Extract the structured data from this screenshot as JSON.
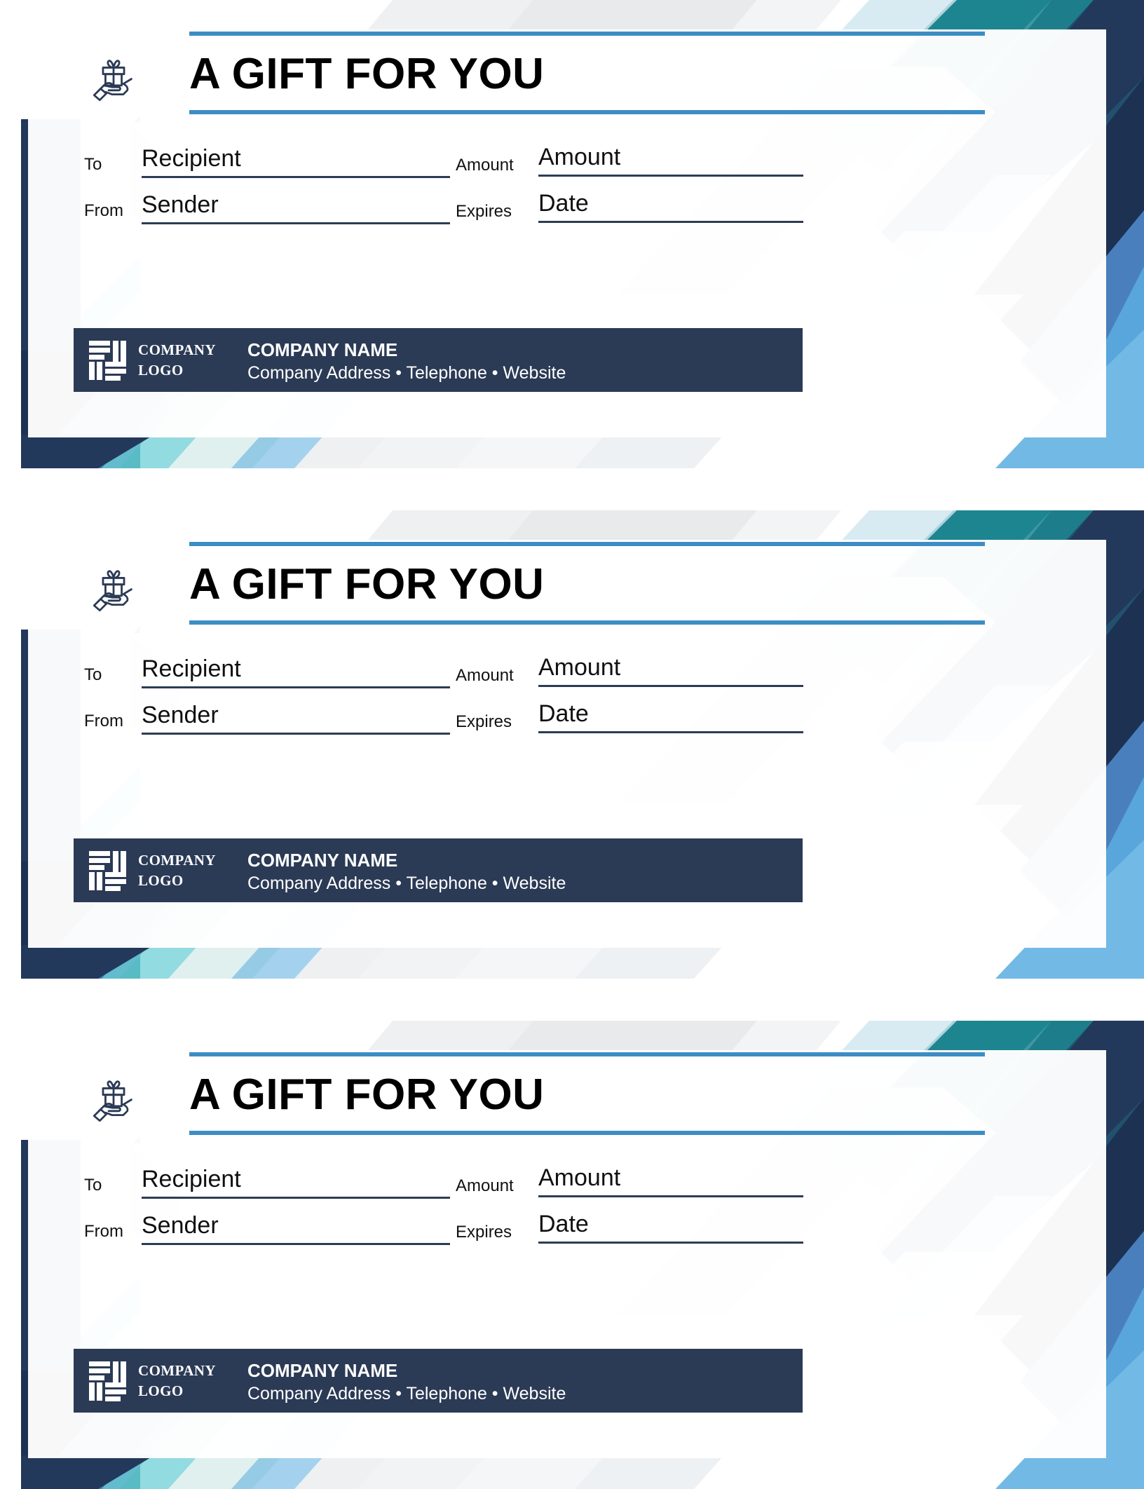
{
  "document": {
    "kind": "gift-certificate-template-sheet",
    "certificate_count": 3
  },
  "certificate": {
    "title": "A GIFT FOR YOU",
    "gift_icon": "hand-holding-gift-icon",
    "fields": {
      "to_label": "To",
      "to_value": "Recipient",
      "from_label": "From",
      "from_value": "Sender",
      "amount_label": "Amount",
      "amount_value": "Amount",
      "expires_label": "Expires",
      "expires_value": "Date"
    },
    "footer": {
      "logo_icon": "company-logo-mark-icon",
      "logo_word_line1": "COMPANY",
      "logo_word_line2": "LOGO",
      "company_name": "COMPANY NAME",
      "company_contact": "Company Address • Telephone • Website"
    }
  },
  "colors": {
    "accent_rule": "#3d8dc4",
    "footer_bar": "#2b3a55",
    "field_line": "#2c3c54",
    "deco_navy": "#22395c",
    "deco_dark_navy": "#1d3152",
    "deco_teal": "#1d8590",
    "deco_teal_light": "#6ecfd6",
    "deco_blue": "#5aade0",
    "deco_blue_mid": "#4a7fbd",
    "deco_pale_blue": "#d3e9f7",
    "deco_pale_mint": "#dff0ee",
    "deco_grey": "#d2d5d9",
    "deco_light_grey": "#eaebec",
    "deco_off_white": "#f4f5f6",
    "title_text": "#000000",
    "panel": "#ffffff"
  }
}
